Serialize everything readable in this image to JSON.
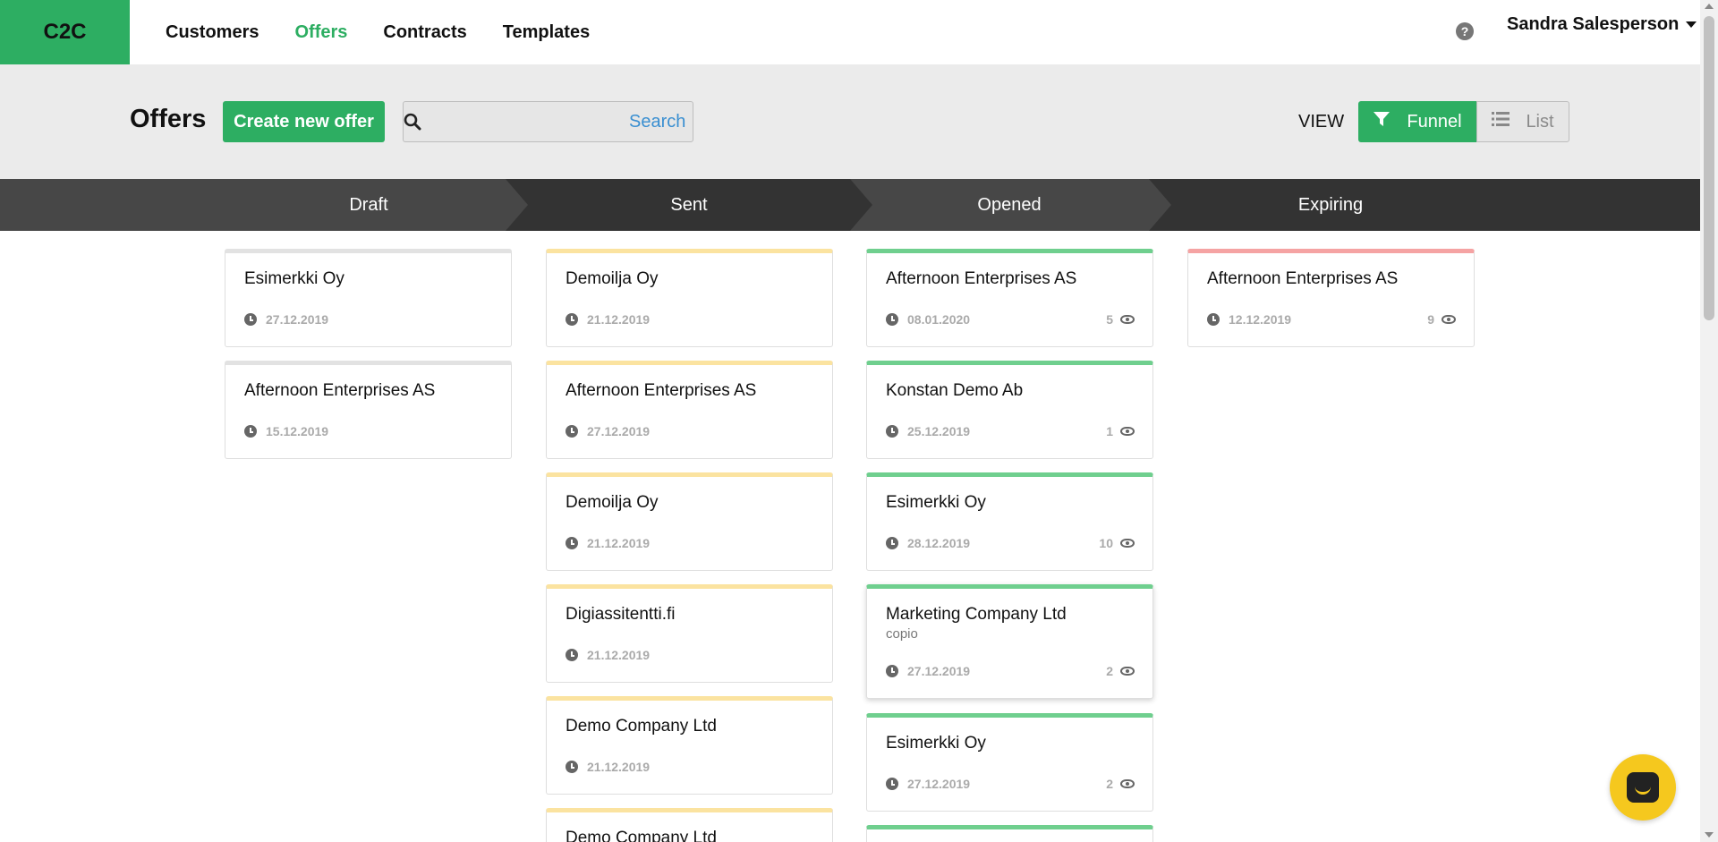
{
  "app": {
    "logo": "C2C"
  },
  "nav": {
    "items": [
      {
        "label": "Customers",
        "active": false
      },
      {
        "label": "Offers",
        "active": true
      },
      {
        "label": "Contracts",
        "active": false
      },
      {
        "label": "Templates",
        "active": false
      }
    ],
    "help_icon": "question-circle-icon",
    "user_name": "Sandra Salesperson"
  },
  "header": {
    "title": "Offers",
    "create_label": "Create new offer",
    "search_placeholder": "",
    "search_button": "Search",
    "view_label": "VIEW",
    "view_funnel": "Funnel",
    "view_list": "List",
    "active_view": "Funnel"
  },
  "stages": [
    "Draft",
    "Sent",
    "Opened",
    "Expiring"
  ],
  "colors": {
    "brand": "#2dae62",
    "draft": "#e2e2e2",
    "sent": "#fbe3a0",
    "opened": "#6fcf8e",
    "expiring": "#f5a3a3"
  },
  "columns": {
    "draft": [
      {
        "name": "Esimerkki Oy",
        "date": "27.12.2019"
      },
      {
        "name": "Afternoon Enterprises AS",
        "date": "15.12.2019"
      }
    ],
    "sent": [
      {
        "name": "Demoilja Oy",
        "date": "21.12.2019"
      },
      {
        "name": "Afternoon Enterprises AS",
        "date": "27.12.2019"
      },
      {
        "name": "Demoilja Oy",
        "date": "21.12.2019"
      },
      {
        "name": "Digiassitentti.fi",
        "date": "21.12.2019"
      },
      {
        "name": "Demo Company Ltd",
        "date": "21.12.2019"
      },
      {
        "name": "Demo Company Ltd",
        "date": ""
      }
    ],
    "opened": [
      {
        "name": "Afternoon Enterprises AS",
        "date": "08.01.2020",
        "views": "5"
      },
      {
        "name": "Konstan Demo Ab",
        "date": "25.12.2019",
        "views": "1"
      },
      {
        "name": "Esimerkki Oy",
        "date": "28.12.2019",
        "views": "10"
      },
      {
        "name": "Marketing Company Ltd",
        "subtitle": "copio",
        "date": "27.12.2019",
        "views": "2"
      },
      {
        "name": "Esimerkki Oy",
        "date": "27.12.2019",
        "views": "2"
      }
    ],
    "expiring": [
      {
        "name": "Afternoon Enterprises AS",
        "date": "12.12.2019",
        "views": "9"
      }
    ]
  }
}
